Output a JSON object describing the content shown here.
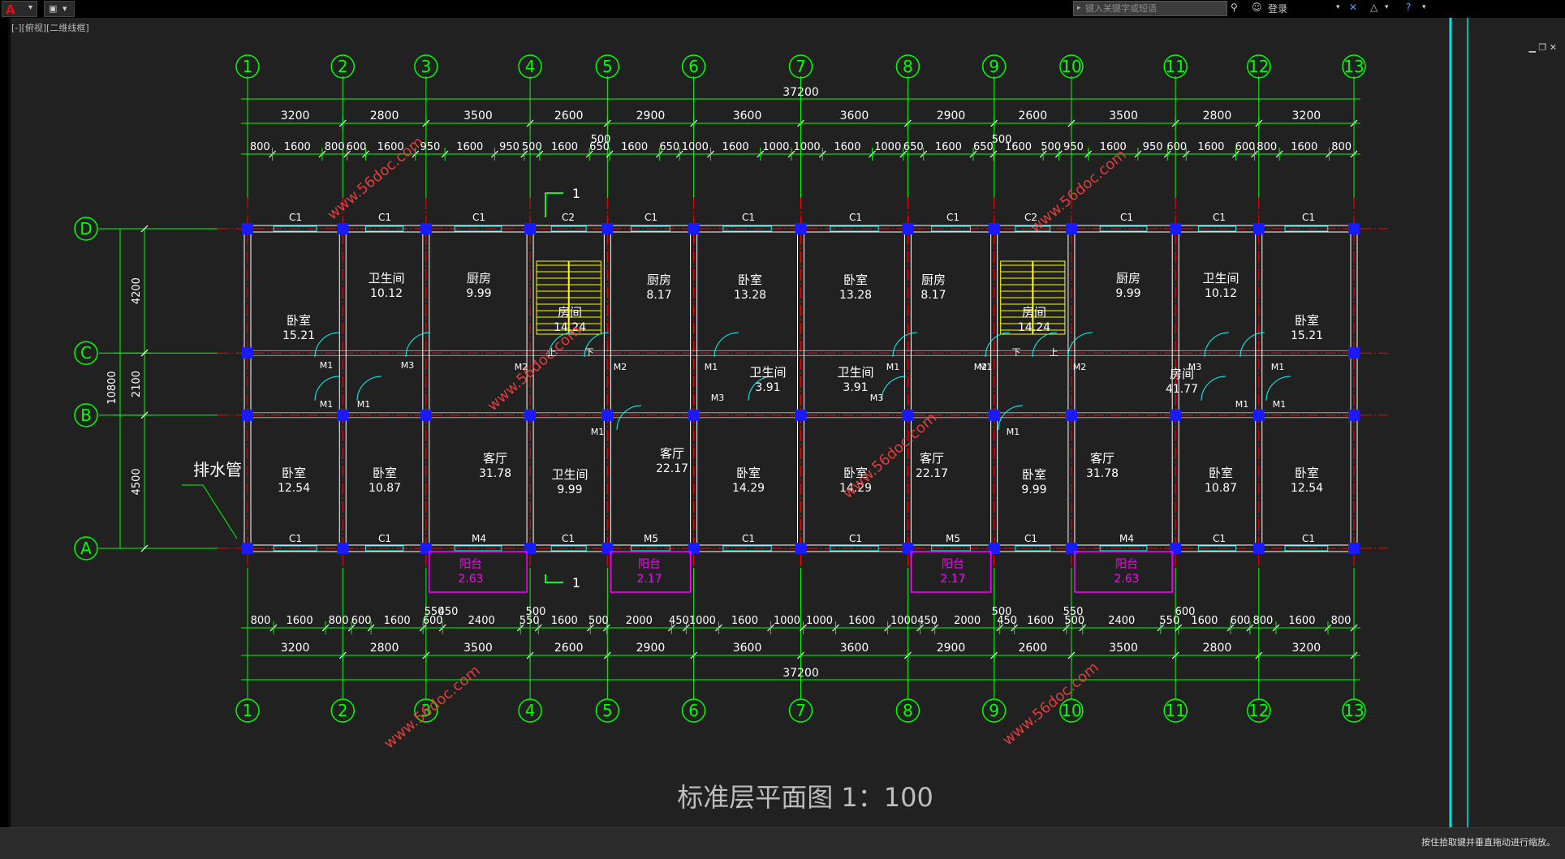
{
  "app": {
    "view_label": "[-][俯视][二维线框]",
    "search_placeholder": "键入关键字或短语",
    "login_label": "登录",
    "status_text": "按住拾取键并垂直拖动进行缩放。"
  },
  "colors": {
    "background": "#212121",
    "grid_line": "#00ff00",
    "axis_line": "#ff0000",
    "wall": "#ffffff",
    "column": "#1a1aff",
    "window": "#00ffff",
    "balcony": "#ff00ff",
    "stair": "#ffff00"
  },
  "drawing": {
    "title": "标准层平面图 1：100",
    "axis_labels_x": [
      "1",
      "2",
      "3",
      "4",
      "5",
      "6",
      "7",
      "8",
      "9",
      "10",
      "11",
      "12",
      "13"
    ],
    "axis_labels_y": [
      "D",
      "C",
      "B",
      "A"
    ],
    "total_dim": "37200",
    "bay_dims_top": [
      "3200",
      "2800",
      "3500",
      "2600",
      "2900",
      "3600",
      "3600",
      "2900",
      "2600",
      "3500",
      "2800",
      "3200"
    ],
    "bay_dims_bottom": [
      "3200",
      "2800",
      "3500",
      "2600",
      "2900",
      "3600",
      "3600",
      "2900",
      "2600",
      "3500",
      "2800",
      "3200"
    ],
    "sub_dims_top": [
      "800",
      "1600",
      "800",
      "600",
      "1600",
      "950",
      "1600",
      "950",
      "500",
      "1600",
      "650",
      "1600",
      "650",
      "1000",
      "1600",
      "1000",
      "1000",
      "1600",
      "1000",
      "650",
      "1600",
      "650",
      "1600",
      "500",
      "950",
      "1600",
      "950",
      "600",
      "1600",
      "600",
      "800",
      "1600",
      "800"
    ],
    "sub_dims_bottom": [
      "800",
      "1600",
      "800",
      "600",
      "1600",
      "600",
      "2400",
      "550",
      "1600",
      "500",
      "2000",
      "450",
      "1000",
      "1600",
      "1000",
      "1000",
      "1600",
      "1000",
      "450",
      "2000",
      "450",
      "1600",
      "500",
      "2400",
      "550",
      "1600",
      "600",
      "800",
      "1600",
      "800"
    ],
    "extra_dims": [
      "500",
      "500",
      "550",
      "500",
      "450",
      "500",
      "550",
      "600"
    ],
    "vertical_dims": [
      "4200",
      "2100",
      "4500"
    ],
    "total_vertical": "10800",
    "section_mark": "1",
    "drain_label": "排水管",
    "rooms": [
      {
        "name": "卧室",
        "area": "15.21"
      },
      {
        "name": "卫生间",
        "area": "10.12"
      },
      {
        "name": "厨房",
        "area": "9.99"
      },
      {
        "name": "房间",
        "area": "14.24"
      },
      {
        "name": "厨房",
        "area": "8.17"
      },
      {
        "name": "卧室",
        "area": "13.28"
      },
      {
        "name": "卧室",
        "area": "13.28"
      },
      {
        "name": "厨房",
        "area": "8.17"
      },
      {
        "name": "房间",
        "area": "14.24"
      },
      {
        "name": "厨房",
        "area": "9.99"
      },
      {
        "name": "卫生间",
        "area": "10.12"
      },
      {
        "name": "卧室",
        "area": "15.21"
      },
      {
        "name": "卫生间",
        "area": "3.91"
      },
      {
        "name": "卫生间",
        "area": "3.91"
      },
      {
        "name": "房间",
        "area": "41.77"
      },
      {
        "name": "卧室",
        "area": "12.54"
      },
      {
        "name": "卧室",
        "area": "10.87"
      },
      {
        "name": "客厅",
        "area": "31.78"
      },
      {
        "name": "卫生间",
        "area": "9.99"
      },
      {
        "name": "客厅",
        "area": "22.17"
      },
      {
        "name": "卧室",
        "area": "14.29"
      },
      {
        "name": "卧室",
        "area": "14.29"
      },
      {
        "name": "客厅",
        "area": "22.17"
      },
      {
        "name": "卧室",
        "area": "9.99"
      },
      {
        "name": "客厅",
        "area": "31.78"
      },
      {
        "name": "卧室",
        "area": "10.87"
      },
      {
        "name": "卧室",
        "area": "12.54"
      }
    ],
    "balconies": [
      {
        "name": "阳台",
        "area": "2.63"
      },
      {
        "name": "阳台",
        "area": "2.17"
      },
      {
        "name": "阳台",
        "area": "2.17"
      },
      {
        "name": "阳台",
        "area": "2.63"
      }
    ],
    "window_tags_top": [
      "C1",
      "C1",
      "C1",
      "C2",
      "C1",
      "C1",
      "C1",
      "C1",
      "C2",
      "C1",
      "C1",
      "C1"
    ],
    "window_tags_bottom": [
      "C1",
      "C1",
      "M4",
      "C1",
      "M5",
      "C1",
      "C1",
      "M5",
      "C1",
      "M4",
      "C1",
      "C1"
    ],
    "door_tags": [
      "M1",
      "M3",
      "M1",
      "M1",
      "M2",
      "M2",
      "M1",
      "M3",
      "M1",
      "M3",
      "M1",
      "M2",
      "M2",
      "M3",
      "M1",
      "M1",
      "M1",
      "M1",
      "M1"
    ],
    "stair_marks": [
      "上",
      "下",
      "下",
      "上"
    ],
    "watermark": "www.56doc.com"
  }
}
